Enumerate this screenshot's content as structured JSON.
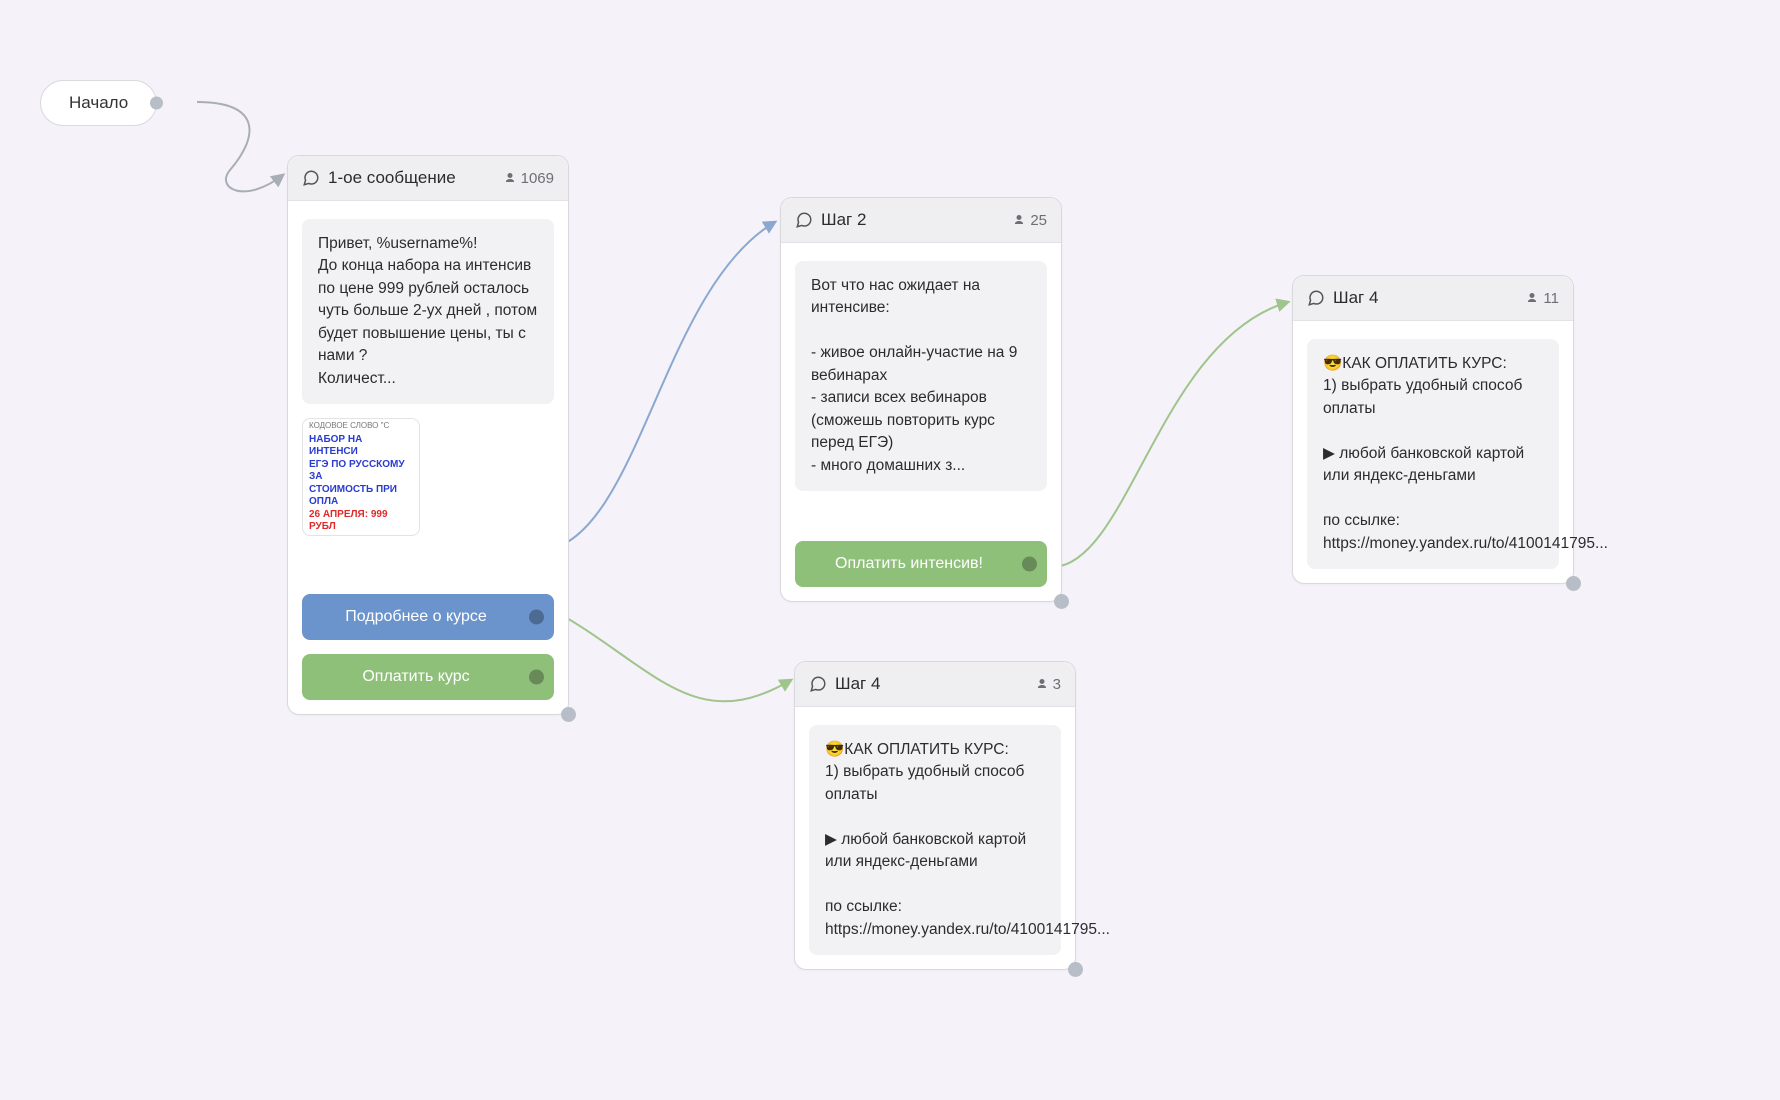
{
  "start": {
    "label": "Начало"
  },
  "node1": {
    "title": "1-ое сообщение",
    "user_count": "1069",
    "message": "Привет, %username%!\nДо конца набора на интенсив по цене 999 рублей осталось чуть больше 2-ух дней , потом будет повышение цены, ты с нами ?\nКоличест...",
    "thumb_lines": {
      "l0": "КОДОВОЕ СЛОВО \"С",
      "l1": "НАБОР НА ИНТЕНСИ",
      "l2": "ЕГЭ ПО РУССКОМУ ЗА",
      "l3": "СТОИМОСТЬ ПРИ ОПЛА",
      "l4": "26 АПРЕЛЯ: 999 РУБЛ"
    },
    "btn_more": "Подробнее о курсе",
    "btn_pay": "Оплатить курс"
  },
  "node2": {
    "title": "Шаг 2",
    "user_count": "25",
    "message": "Вот что нас ожидает на интенсиве:\n\n- живое онлайн-участие на 9 вебинарах\n- записи всех вебинаров (сможешь повторить курс перед ЕГЭ)\n- много домашних з...",
    "btn_pay": "Оплатить интенсив!"
  },
  "node3": {
    "title": "Шаг 4",
    "user_count": "3",
    "message": "😎КАК ОПЛАТИТЬ КУРС:\n1) выбрать удобный способ оплаты\n\n▶ любой банковской картой или яндекс-деньгами\n\nпо ссылке:\nhttps://money.yandex.ru/to/4100141795..."
  },
  "node4": {
    "title": "Шаг 4",
    "user_count": "11",
    "message": "😎КАК ОПЛАТИТЬ КУРС:\n1) выбрать удобный способ оплаты\n\n▶ любой банковской картой или яндекс-деньгами\n\nпо ссылке:\nhttps://money.yandex.ru/to/4100141795..."
  }
}
